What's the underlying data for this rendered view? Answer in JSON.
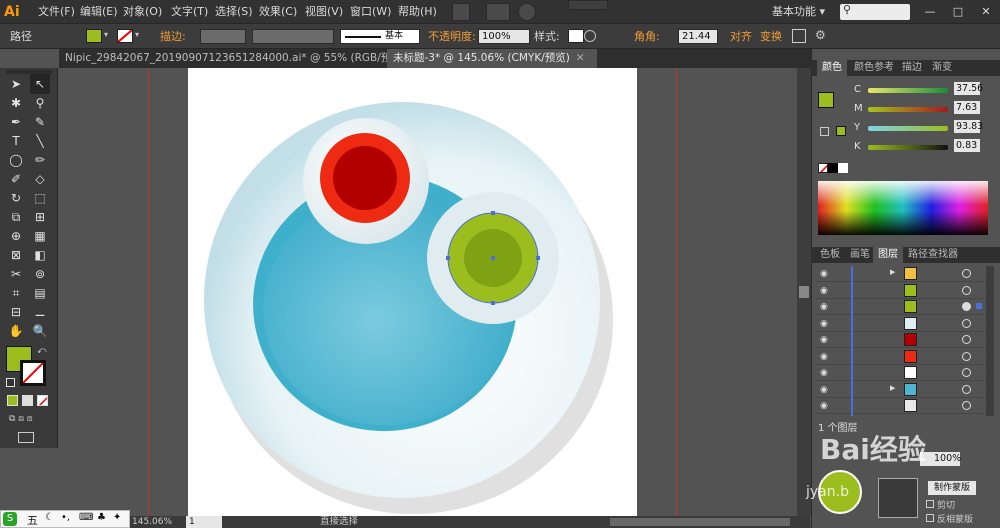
{
  "menubar": {
    "logo": "Ai",
    "items": [
      "文件(F)",
      "编辑(E)",
      "对象(O)",
      "文字(T)",
      "选择(S)",
      "效果(C)",
      "视图(V)",
      "窗口(W)",
      "帮助(H)"
    ],
    "workspace": "基本功能",
    "workspace_arrow": "▾",
    "window_buttons": [
      "—",
      "□",
      "✕"
    ]
  },
  "control_bar": {
    "selection_label": "路径",
    "stroke_label": "描边:",
    "stroke_style": "基本",
    "opacity_label": "不透明度:",
    "opacity_value": "100%",
    "style_label": "样式:",
    "corner_label": "角角:",
    "corner_value": "21.44",
    "align_label": "对齐",
    "transform_label": "变换",
    "fill_color": "#9bbd1e"
  },
  "tabs": [
    {
      "label": "Nipic_29842067_20190907123651284000.ai* @ 55% (RGB/预览)",
      "active": false,
      "close": "✕"
    },
    {
      "label": "未标题-3* @ 145.06% (CMYK/预览)",
      "active": true,
      "close": "✕"
    }
  ],
  "tools": [
    "➤",
    "↖",
    "✱",
    "⚲",
    "✒",
    "✎",
    "T",
    "╲",
    "◯",
    "✏",
    "✐",
    "◇",
    "↻",
    "⬚",
    "⧉",
    "⊞",
    "⊕",
    "▦",
    "⊠",
    "◧",
    "✂",
    "⊚",
    "⌗",
    "▤",
    "⊟",
    "⚊",
    "✋",
    "🔍"
  ],
  "toolbar": {
    "fill_color": "#9bbd1e"
  },
  "color_panel": {
    "tabs": [
      "颜色",
      "颜色参考",
      "描边",
      "渐变"
    ],
    "channels": [
      {
        "name": "C",
        "value": "37.56"
      },
      {
        "name": "M",
        "value": "7.63"
      },
      {
        "name": "Y",
        "value": "93.83"
      },
      {
        "name": "K",
        "value": "0.83"
      }
    ],
    "current_color": "#9bbd1e"
  },
  "layers_panel": {
    "tabs": [
      "色板",
      "画笔",
      "图层",
      "路径查找器"
    ],
    "rows": [
      {
        "color": "#f0c040",
        "expand": "▶"
      },
      {
        "color": "#9bbd1e",
        "expand": ""
      },
      {
        "color": "#9bbd1e",
        "expand": ""
      },
      {
        "color": "#dfeef2",
        "expand": ""
      },
      {
        "color": "#b20000",
        "expand": ""
      },
      {
        "color": "#ee2a12",
        "expand": ""
      },
      {
        "color": "#ffffff",
        "expand": ""
      },
      {
        "color": "#4fb5cf",
        "expand": "▶"
      },
      {
        "color": "#e8e8e8",
        "expand": ""
      }
    ],
    "footer": "1 个图层",
    "opacity_value": "100%",
    "clip_label": "剪切",
    "invert_label": "反相蒙版",
    "mask_button": "制作蒙版"
  },
  "statusbar": {
    "zoom": "145.06%",
    "page": "1",
    "tool": "直接选择"
  },
  "ime": {
    "label": "五"
  },
  "watermark": {
    "text": "Bai经验",
    "sub": "jyan.b"
  }
}
